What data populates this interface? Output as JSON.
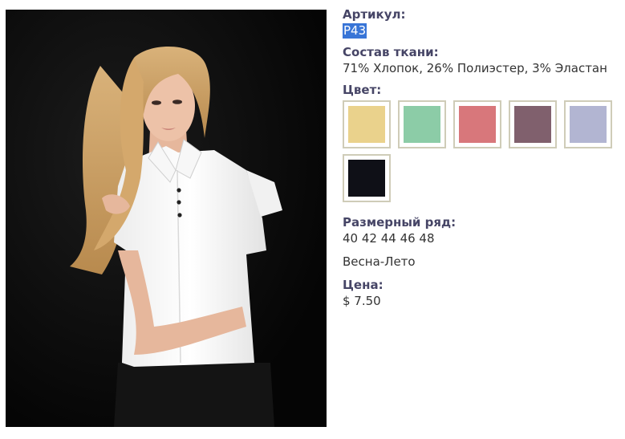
{
  "product": {
    "photo_alt": "",
    "article_label": "Артикул:",
    "article_value": "P43",
    "fabric_label": "Состав ткани:",
    "fabric_value": "71% Хлопок, 26% Полиэстер, 3% Эластан",
    "color_label": "Цвет:",
    "colors": [
      {
        "name": "yellow",
        "hex": "#ead28c"
      },
      {
        "name": "mint",
        "hex": "#8ccca7"
      },
      {
        "name": "pink",
        "hex": "#d8777b"
      },
      {
        "name": "mauve",
        "hex": "#80606d"
      },
      {
        "name": "lavender",
        "hex": "#b2b5d2"
      },
      {
        "name": "black",
        "hex": "#0f1017"
      }
    ],
    "sizes_label": "Размерный ряд:",
    "sizes_value": "40 42 44 46 48",
    "season": "Весна-Лето",
    "price_label": "Цена:",
    "price_value": "$ 7.50"
  }
}
